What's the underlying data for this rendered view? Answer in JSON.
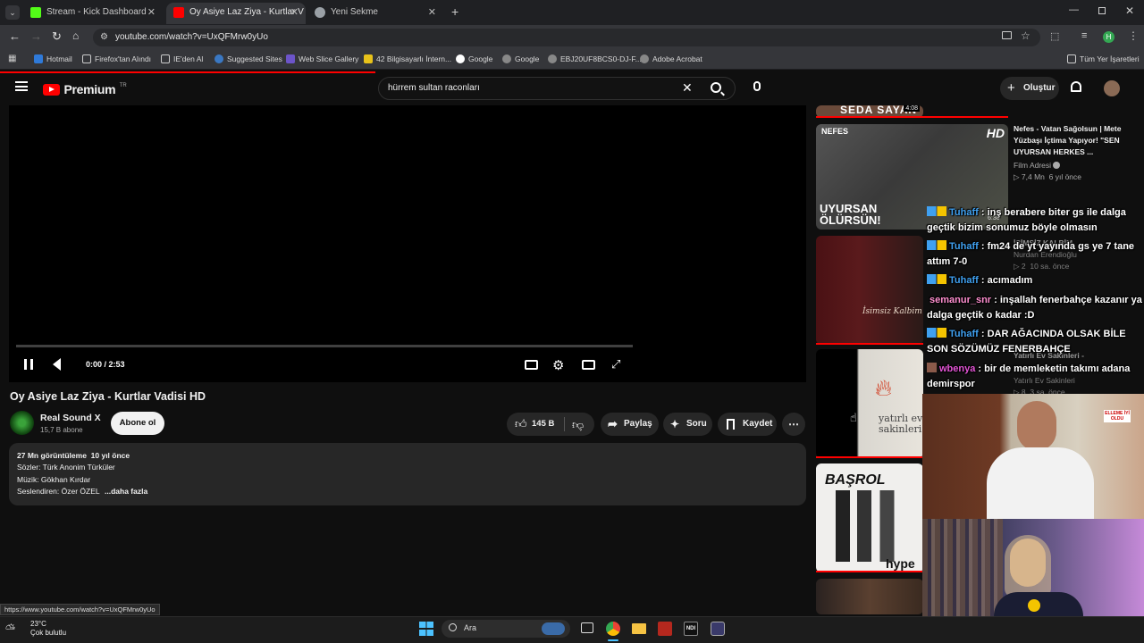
{
  "browser": {
    "tabs": [
      {
        "title": "Stream - Kick Dashboard",
        "active": false,
        "icon_color": "#53fc18"
      },
      {
        "title": "Oy Asiye Laz Ziya - Kurtlar V",
        "active": true,
        "icon_color": "#ff0000"
      },
      {
        "title": "Yeni Sekme",
        "active": false,
        "icon_color": "#9aa0a6"
      }
    ],
    "url": "youtube.com/watch?v=UxQFMrw0yUo",
    "bookmarks": [
      "Hotmail",
      "Firefox'tan Alındı",
      "IE'den Al",
      "Suggested Sites",
      "Web Slice Gallery",
      "42 Bilgisayarlı İntern...",
      "Google",
      "Google",
      "EBJ20UF8BCS0-DJ-F...",
      "Adobe Acrobat"
    ],
    "bookmarks_other": "Tüm Yer İşaretleri",
    "profile_letter": "H"
  },
  "youtube": {
    "logo": "Premium",
    "logo_region": "TR",
    "search_value": "hürrem sultan raconları",
    "create_label": "Oluştur",
    "player": {
      "time": "0:00 / 2:53"
    },
    "video_title": "Oy Asiye Laz Ziya - Kurtlar Vadisi HD",
    "channel": {
      "name": "Real Sound X",
      "subs": "15,7 B abone",
      "subscribe": "Abone ol"
    },
    "actions": {
      "likes": "145 B",
      "share": "Paylaş",
      "ask": "Soru",
      "save": "Kaydet"
    },
    "description": {
      "stats": "27 Mn görüntüleme  10 yıl önce",
      "lines": [
        "Sözler: Türk Anonim Türküler",
        "Müzik: Gökhan Kırdar",
        "Seslendiren: Özer ÖZEL"
      ],
      "more": "...daha fazla"
    },
    "status_url": "https://www.youtube.com/watch?v=UxQFMrw0yUo",
    "sidebar": [
      {
        "thumb_text": "SEDA SAYAN",
        "duration": "4:08"
      },
      {
        "title": "Nefes - Vatan Sağolsun | Mete Yüzbaşı İçtima Yapıyor! \"SEN UYURSAN HERKES ...",
        "channel": "Film Adresi",
        "meta": "7,4 Mn  6 yıl önce",
        "thumb_top": "NEFES",
        "thumb_badge": "HD",
        "thumb_bottom": "UYURSAN ÖLÜRSÜN!",
        "duration": "6:30"
      },
      {
        "title": "İSİMSİZ KALBİM",
        "channel": "Nurdan Erendioğlu",
        "meta": "2  10 sa. önce",
        "thumb_text": "İsimsiz Kalbim"
      },
      {
        "title": "Yatırlı Ev Sakinleri -",
        "channel": "Yatırlı Ev Sakinleri",
        "meta": "8  3 sa. önce",
        "thumb_text": "yatırlı ev sakinleri"
      },
      {
        "thumb_text": "BAŞROL",
        "thumb_sub": "hype"
      }
    ]
  },
  "chat": [
    {
      "user": "Tuhaff",
      "color": "#3fa0f0",
      "text": "inş berabere biter gs ile dalga geçtik bizim sonumuz böyle olmasın"
    },
    {
      "user": "Tuhaff",
      "color": "#3fa0f0",
      "text": "fm24 de yt yayında gs ye 7 tane attım 7-0"
    },
    {
      "user": "Tuhaff",
      "color": "#3fa0f0",
      "text": "acımadım"
    },
    {
      "user": "semanur_snr",
      "color": "#ff8fd0",
      "text": "inşallah fenerbahçe kazanır ya dalga geçtik o kadar :D"
    },
    {
      "user": "Tuhaff",
      "color": "#3fa0f0",
      "text": "DAR AĞACINDA OLSAK BİLE SON SÖZÜMÜZ FENERBAHÇE"
    },
    {
      "user": "wbenya",
      "color": "#e455d6",
      "text": "bir de memleketin takımı adana demirspor"
    }
  ],
  "webcam": {
    "sticker": "ELLEME İYİ OLDU"
  },
  "taskbar": {
    "temp": "23°C",
    "weather": "Çok bulutlu",
    "search": "Ara"
  }
}
